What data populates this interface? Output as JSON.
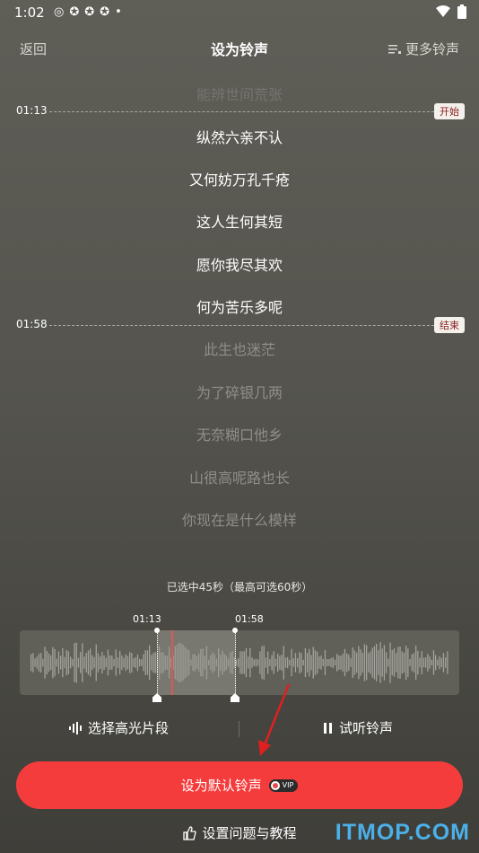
{
  "status": {
    "time": "1:02"
  },
  "header": {
    "back_label": "返回",
    "title": "设为铃声",
    "more_label": "更多铃声"
  },
  "lyrics": {
    "top_partial": "能辨世间荒张",
    "lines_selected": [
      "纵然六亲不认",
      "又何妨万孔千疮",
      "这人生何其短",
      "愿你我尽其欢",
      "何为苦乐多呢"
    ],
    "lines_after": [
      "此生也迷茫",
      "为了碎银几两",
      "无奈糊口他乡",
      "山很高呢路也长",
      "你现在是什么模样"
    ]
  },
  "markers": {
    "start": {
      "time": "01:13",
      "tag": "开始"
    },
    "end": {
      "time": "01:58",
      "tag": "结束"
    }
  },
  "selection": {
    "info": "已选中45秒（最高可选60秒）",
    "start_label": "01:13",
    "end_label": "01:58"
  },
  "actions": {
    "highlight_label": "选择高光片段",
    "preview_label": "试听铃声"
  },
  "primary": {
    "label": "设为默认铃声",
    "vip": "VIP"
  },
  "help": {
    "label": "设置问题与教程"
  },
  "watermark": "ITMOP.COM",
  "colors": {
    "accent": "#f53c3c",
    "tag_text": "#8a1b1b"
  }
}
